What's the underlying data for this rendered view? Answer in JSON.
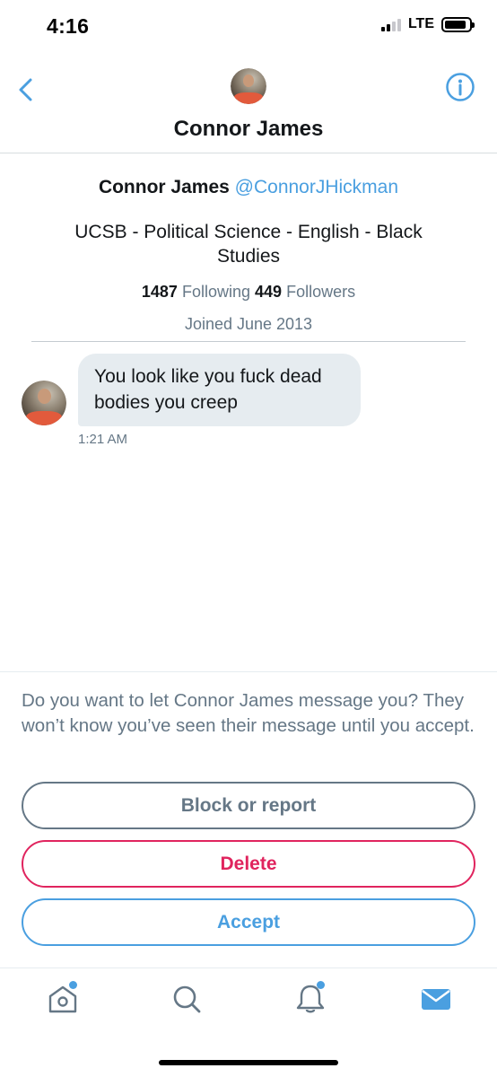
{
  "status_bar": {
    "time": "4:16",
    "network": "LTE",
    "signal_bars": 2,
    "battery_level": 0.9
  },
  "header": {
    "title": "Connor James",
    "back_icon": "chevron-left-icon",
    "info_icon": "info-circle-icon"
  },
  "profile": {
    "name": "Connor James",
    "handle": "@ConnorJHickman",
    "bio": "UCSB - Political Science - English - Black Studies",
    "following_count": "1487",
    "following_label": "Following",
    "followers_count": "449",
    "followers_label": "Followers",
    "joined": "Joined June 2013"
  },
  "message": {
    "text": "You look like you fuck dead bodies you creep",
    "time": "1:21 AM"
  },
  "request": {
    "prompt": "Do you want to let Connor James message you? They won’t know you’ve seen their message until you accept.",
    "block_label": "Block or report",
    "delete_label": "Delete",
    "accept_label": "Accept"
  },
  "tab_bar": {
    "items": [
      {
        "icon": "home-icon",
        "has_badge": true
      },
      {
        "icon": "search-icon",
        "has_badge": false
      },
      {
        "icon": "bell-icon",
        "has_badge": true
      },
      {
        "icon": "mail-icon",
        "has_badge": false,
        "active": true
      }
    ]
  },
  "colors": {
    "accent": "#4a9fe0",
    "danger": "#e0245e",
    "muted": "#657786",
    "bubble": "#e6ecf0"
  }
}
